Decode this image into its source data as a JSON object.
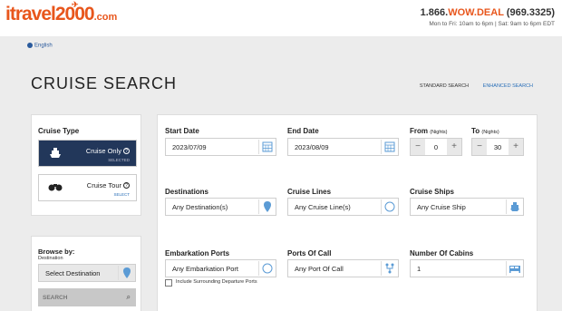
{
  "header": {
    "logo_main": "itravel2000",
    "logo_suffix": ".com",
    "phone_prefix": "1.866.",
    "phone_wow": "WOW.DEAL",
    "phone_digits": " (969.3325)",
    "hours": "Mon to Fri: 10am to 6pm | Sat: 9am to 6pm EDT"
  },
  "language": "English",
  "page_title": "CRUISE SEARCH",
  "search_modes": {
    "standard": "STANDARD SEARCH",
    "enhanced": "ENHANCED SEARCH"
  },
  "cruise_type": {
    "heading": "Cruise Type",
    "options": [
      {
        "label": "Cruise Only",
        "status": "SELECTED",
        "icon": "ship-icon"
      },
      {
        "label": "Cruise Tour",
        "status": "SELECT",
        "icon": "binoculars-icon"
      }
    ]
  },
  "browse": {
    "heading": "Browse by:",
    "sub": "Destination",
    "select_value": "Select Destination",
    "search_placeholder": "SEARCH"
  },
  "form": {
    "start_date": {
      "label": "Start Date",
      "value": "2023/07/09"
    },
    "end_date": {
      "label": "End Date",
      "value": "2023/08/09"
    },
    "from": {
      "label": "From",
      "unit": "(Nights)",
      "value": "0"
    },
    "to": {
      "label": "To",
      "unit": "(Nights)",
      "value": "30"
    },
    "destinations": {
      "label": "Destinations",
      "value": "Any Destination(s)"
    },
    "cruise_lines": {
      "label": "Cruise Lines",
      "value": "Any Cruise Line(s)"
    },
    "cruise_ships": {
      "label": "Cruise Ships",
      "value": "Any Cruise Ship"
    },
    "embarkation": {
      "label": "Embarkation Ports",
      "value": "Any Embarkation Port"
    },
    "ports_of_call": {
      "label": "Ports Of Call",
      "value": "Any Port Of Call"
    },
    "cabins": {
      "label": "Number Of Cabins",
      "value": "1"
    },
    "surrounding_label": "Include Surrounding Departure Ports"
  },
  "stepper": {
    "minus": "−",
    "plus": "+"
  },
  "colors": {
    "brand": "#e8561c",
    "navy": "#22375a",
    "link": "#2a6fb8",
    "icon_blue": "#5b9bd5"
  }
}
